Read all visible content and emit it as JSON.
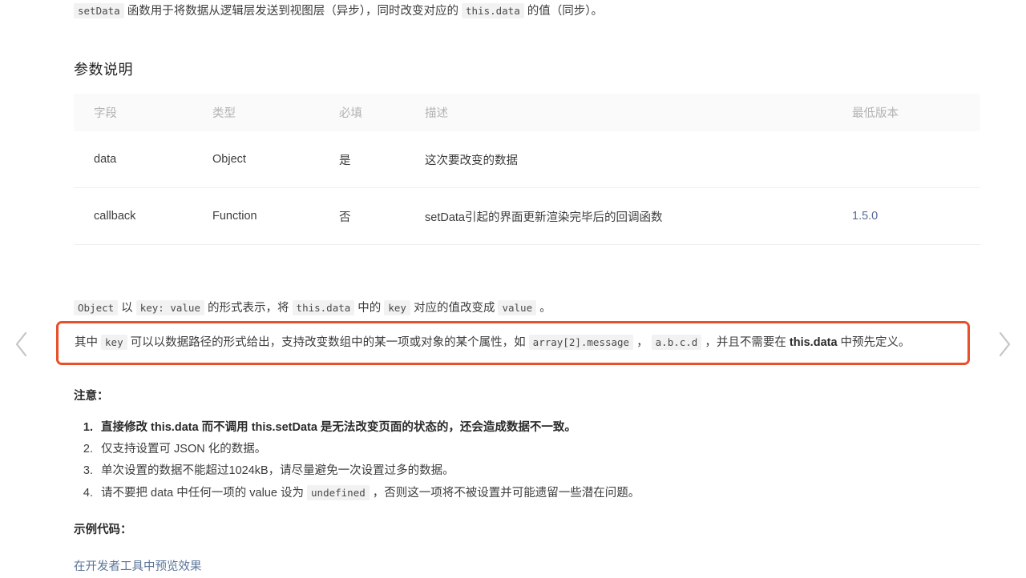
{
  "intro": {
    "code_setdata": "setData",
    "text_1": " 函数用于将数据从逻辑层发送到视图层（异步），同时改变对应的 ",
    "code_thisdata": "this.data",
    "text_2": " 的值（同步）。"
  },
  "section": {
    "title": "参数说明"
  },
  "table": {
    "headers": [
      "字段",
      "类型",
      "必填",
      "描述",
      "最低版本"
    ],
    "rows": [
      {
        "field": "data",
        "type": "Object",
        "required": "是",
        "description": "这次要改变的数据",
        "version": ""
      },
      {
        "field": "callback",
        "type": "Function",
        "required": "否",
        "description": "setData引起的界面更新渲染完毕后的回调函数",
        "version": "1.5.0"
      }
    ]
  },
  "object_para": {
    "code_object": "Object",
    "t1": " 以 ",
    "code_keyvalue": "key: value",
    "t2": " 的形式表示，将 ",
    "code_thisdata": "this.data",
    "t3": " 中的 ",
    "code_key": "key",
    "t4": " 对应的值改变成 ",
    "code_value": "value",
    "t5": " 。"
  },
  "highlight": {
    "t1": "其中 ",
    "code_key": "key",
    "t2": " 可以以数据路径的形式给出，支持改变数组中的某一项或对象的某个属性，如 ",
    "code_array": "array[2].message",
    "t3": " ， ",
    "code_abcd": "a.b.c.d",
    "t4": " ，并且不需要在 ",
    "bold_thisdata": "this.data",
    "t5": " 中预先定义。",
    "border_color": "#e8502a"
  },
  "notice": {
    "title": "注意：",
    "items": [
      {
        "t1": "直接修改 this.data 而不调用 this.setData 是无法改变页面的状态的，还会造成数据不一致。",
        "bold": true
      },
      {
        "t1": "仅支持设置可 JSON 化的数据。",
        "bold": false
      },
      {
        "t1": "单次设置的数据不能超过1024kB，请尽量避免一次设置过多的数据。",
        "bold": false
      },
      {
        "pre": "请不要把 data 中任何一项的 value 设为 ",
        "code": "undefined",
        "post": " ，否则这一项将不被设置并可能遗留一些潜在问题。",
        "bold": false
      }
    ]
  },
  "sample": {
    "title": "示例代码：",
    "preview_link": "在开发者工具中预览效果"
  },
  "nav": {
    "prev_icon": "chevron-left-icon",
    "next_icon": "chevron-right-icon"
  }
}
